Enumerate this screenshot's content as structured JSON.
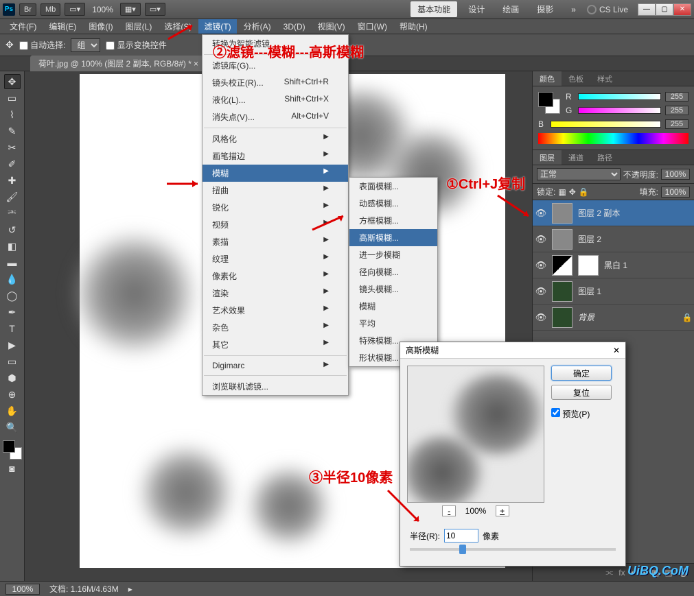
{
  "titlebar": {
    "ps": "Ps",
    "br": "Br",
    "mb": "Mb",
    "zoom": "100%",
    "modes": [
      "基本功能",
      "设计",
      "绘画",
      "摄影"
    ],
    "cslive": "CS Live"
  },
  "menubar": [
    "文件(F)",
    "编辑(E)",
    "图像(I)",
    "图层(L)",
    "选择(S)",
    "滤镜(T)",
    "分析(A)",
    "3D(D)",
    "视图(V)",
    "窗口(W)",
    "帮助(H)"
  ],
  "menubar_open_index": 5,
  "optionsbar": {
    "auto_select": "自动选择:",
    "group": "组",
    "show_transform": "显示变换控件"
  },
  "doc_tab": "荷叶.jpg @ 100% (图层 2 副本, RGB/8#) *",
  "filter_menu": {
    "top": [
      {
        "label": "转换为智能滤镜"
      }
    ],
    "group1": [
      {
        "label": "滤镜库(G)..."
      },
      {
        "label": "镜头校正(R)...",
        "short": "Shift+Ctrl+R"
      },
      {
        "label": "液化(L)...",
        "short": "Shift+Ctrl+X"
      },
      {
        "label": "消失点(V)...",
        "short": "Alt+Ctrl+V"
      }
    ],
    "group2": [
      {
        "label": "风格化",
        "sub": true
      },
      {
        "label": "画笔描边",
        "sub": true
      },
      {
        "label": "模糊",
        "sub": true,
        "hover": true
      },
      {
        "label": "扭曲",
        "sub": true
      },
      {
        "label": "锐化",
        "sub": true
      },
      {
        "label": "视频",
        "sub": true
      },
      {
        "label": "素描",
        "sub": true
      },
      {
        "label": "纹理",
        "sub": true
      },
      {
        "label": "像素化",
        "sub": true
      },
      {
        "label": "渲染",
        "sub": true
      },
      {
        "label": "艺术效果",
        "sub": true
      },
      {
        "label": "杂色",
        "sub": true
      },
      {
        "label": "其它",
        "sub": true
      }
    ],
    "group3": [
      {
        "label": "Digimarc",
        "sub": true
      }
    ],
    "group4": [
      {
        "label": "浏览联机滤镜..."
      }
    ]
  },
  "blur_submenu": [
    "表面模糊...",
    "动感模糊...",
    "方框模糊...",
    "高斯模糊...",
    "进一步模糊",
    "径向模糊...",
    "镜头模糊...",
    "模糊",
    "平均",
    "特殊模糊...",
    "形状模糊..."
  ],
  "blur_hover_index": 3,
  "color_panel": {
    "tabs": [
      "颜色",
      "色板",
      "样式"
    ],
    "r": "255",
    "g": "255",
    "b": "255",
    "labels": {
      "r": "R",
      "g": "G",
      "b": "B"
    }
  },
  "layers_panel": {
    "tabs": [
      "图层",
      "通道",
      "路径"
    ],
    "blend": "正常",
    "opacity_label": "不透明度:",
    "opacity": "100%",
    "lock_label": "锁定:",
    "fill_label": "填充:",
    "fill": "100%",
    "layers": [
      {
        "name": "图层 2 副本",
        "sel": true,
        "thumb": "gray"
      },
      {
        "name": "图层 2",
        "thumb": "gray"
      },
      {
        "name": "黑白 1",
        "thumb": "bw",
        "adj": true
      },
      {
        "name": "图层 1",
        "thumb": "green"
      },
      {
        "name": "背景",
        "thumb": "green",
        "locked": true,
        "bg": true
      }
    ]
  },
  "dialog": {
    "title": "高斯模糊",
    "ok": "确定",
    "cancel": "复位",
    "preview": "预览(P)",
    "zoom": "100%",
    "radius_label": "半径(R):",
    "radius": "10",
    "unit": "像素"
  },
  "annotations": {
    "a1": "①Ctrl+J复制",
    "a2": "②滤镜---模糊---高斯模糊",
    "a3": "③半径10像素"
  },
  "statusbar": {
    "zoom": "100%",
    "doc": "文档: 1.16M/4.63M"
  },
  "watermark": "UiBQ.CoM"
}
